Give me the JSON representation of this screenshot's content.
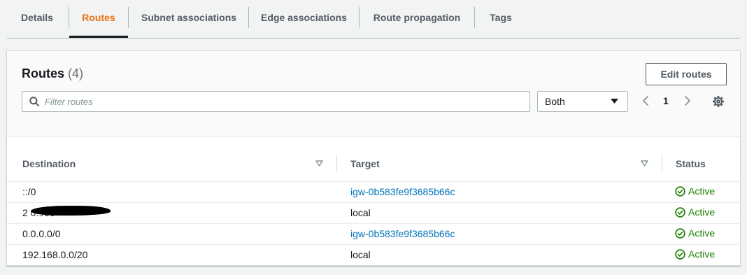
{
  "tabs": [
    "Details",
    "Routes",
    "Subnet associations",
    "Edge associations",
    "Route propagation",
    "Tags"
  ],
  "active_tab": "Routes",
  "panel": {
    "title": "Routes",
    "count": "(4)",
    "edit_button": "Edit routes",
    "filter_placeholder": "Filter routes",
    "select_value": "Both",
    "page": "1"
  },
  "table": {
    "headers": [
      "Destination",
      "Target",
      "Status"
    ],
    "rows": [
      {
        "destination": "::/0",
        "target": "igw-0b583fe9f3685b66c",
        "status": "Active"
      },
      {
        "destination": "2                 0::/56",
        "target": "local",
        "status": "Active"
      },
      {
        "destination": "0.0.0.0/0",
        "target": "igw-0b583fe9f3685b66c",
        "status": "Active"
      },
      {
        "destination": "192.168.0.0/20",
        "target": "local",
        "status": "Active"
      }
    ]
  },
  "colors": {
    "active_tab": "#ec7211",
    "link": "#0073bb",
    "success": "#1d8102"
  },
  "icons": [
    "search-icon",
    "caret-down-icon",
    "chevron-left-icon",
    "chevron-right-icon",
    "gear-icon",
    "sort-icon",
    "status-success-icon"
  ]
}
